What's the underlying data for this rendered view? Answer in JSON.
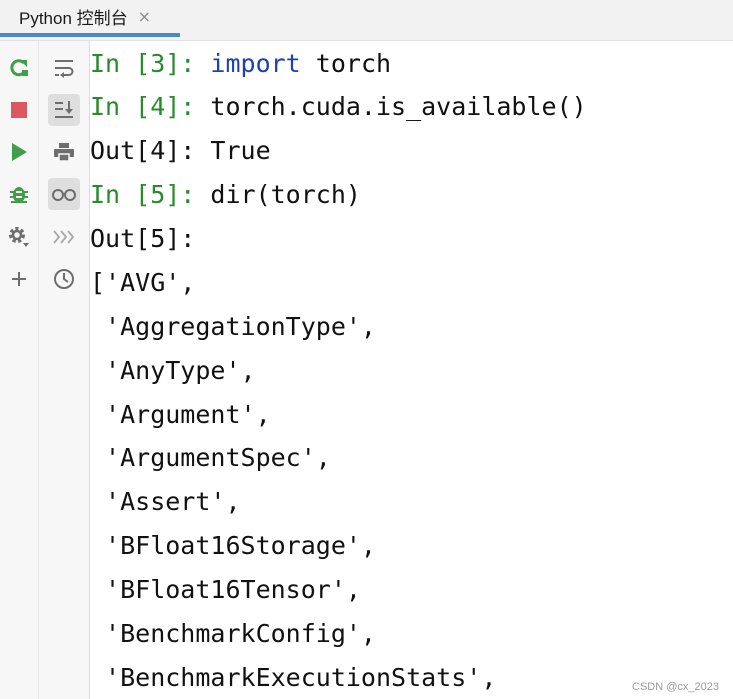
{
  "tab": {
    "title": "Python 控制台",
    "close_glyph": "×"
  },
  "left_toolbar": [
    {
      "icon": "rerun-icon",
      "color": "#3f9e47"
    },
    {
      "icon": "stop-icon",
      "color": "#db5860"
    },
    {
      "icon": "run-icon",
      "color": "#3f9e47"
    },
    {
      "icon": "debug-icon",
      "color": "#3f9e47"
    },
    {
      "icon": "settings-icon",
      "color": "#6e6e6e"
    },
    {
      "icon": "add-icon",
      "color": "#6e6e6e"
    }
  ],
  "right_toolbar": [
    {
      "icon": "soft-wrap-icon",
      "active": false
    },
    {
      "icon": "scroll-to-end-icon",
      "active": true
    },
    {
      "icon": "print-icon",
      "active": false
    },
    {
      "icon": "show-variables-icon",
      "active": true
    },
    {
      "icon": "execute-command-icon",
      "active": false
    },
    {
      "icon": "history-icon",
      "active": false
    }
  ],
  "console": {
    "in3_prompt": "In [3]:",
    "in3_keyword": "import",
    "in3_code": " torch",
    "in4_prompt": "In [4]:",
    "in4_code": " torch.cuda.is_available()",
    "out4_prompt": "Out[4]:",
    "out4_value": " True",
    "in5_prompt": "In [5]:",
    "in5_code": " dir(torch)",
    "out5_prompt": "Out[5]:",
    "output_lines": [
      "['AVG',",
      " 'AggregationType',",
      " 'AnyType',",
      " 'Argument',",
      " 'ArgumentSpec',",
      " 'Assert',",
      " 'BFloat16Storage',",
      " 'BFloat16Tensor',",
      " 'BenchmarkConfig',",
      " 'BenchmarkExecutionStats',"
    ]
  },
  "watermark": "CSDN @cx_2023",
  "colors": {
    "prompt_in": "#2a8a2e",
    "keyword": "#1f3fb8",
    "tab_underline": "#4a88c7"
  }
}
